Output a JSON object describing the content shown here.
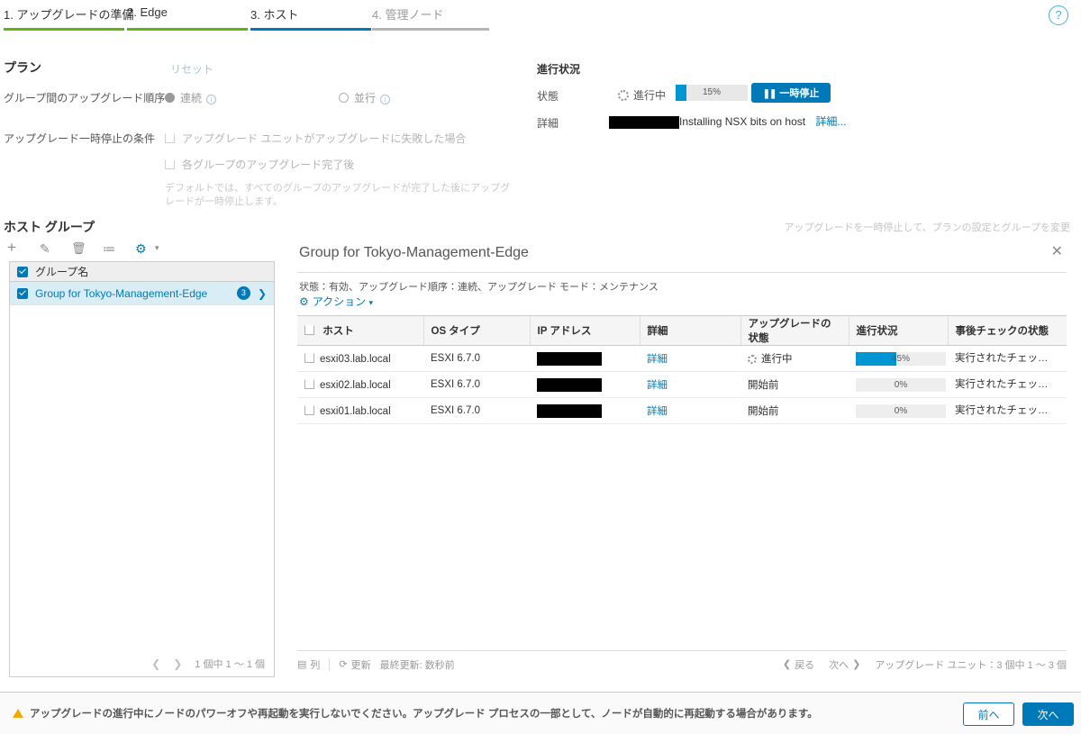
{
  "wizard": {
    "tabs": [
      {
        "label": "1. アップグレードの準備",
        "state": "done"
      },
      {
        "label": "2. Edge",
        "state": "done"
      },
      {
        "label": "3. ホスト",
        "state": "current"
      },
      {
        "label": "4. 管理ノード",
        "state": "future"
      }
    ],
    "help_icon": "?"
  },
  "plan": {
    "title": "プラン",
    "reset_label": "リセット",
    "order_label": "グループ間のアップグレード順序",
    "order_options": [
      {
        "label": "連続",
        "selected": true
      },
      {
        "label": "並行",
        "selected": false
      }
    ],
    "pause_condition_label": "アップグレード一時停止の条件",
    "pause_conditions": [
      {
        "label": "アップグレード ユニットがアップグレードに失敗した場合",
        "checked": false
      },
      {
        "label": "各グループのアップグレード完了後",
        "checked": false
      }
    ],
    "note": "デフォルトでは、すべてのグループのアップグレードが完了した後にアップグレードが一時停止します。"
  },
  "progress": {
    "title": "進行状況",
    "state_label": "状態",
    "state_value": "進行中",
    "percent_text": "15%",
    "percent": 15,
    "pause_button": "一時停止",
    "detail_label": "詳細",
    "detail_text": "Installing NSX bits on host",
    "detail_link": "詳細..."
  },
  "host_groups": {
    "title": "ホスト グループ",
    "hint": "アップグレードを一時停止して、プランの設定とグループを変更",
    "toolbar": [
      {
        "name": "add-icon",
        "glyph": "+"
      },
      {
        "name": "edit-icon",
        "glyph": "✎"
      },
      {
        "name": "delete-icon",
        "glyph": "🗑"
      },
      {
        "name": "reorder-icon",
        "glyph": "≔"
      },
      {
        "name": "settings-icon",
        "glyph": "⚙"
      }
    ],
    "column_header": "グループ名",
    "rows": [
      {
        "name": "Group for Tokyo-Management-Edge",
        "count": "3",
        "selected": true
      }
    ],
    "footer_count": "1 個中 1 ～ 1 個"
  },
  "detail_panel": {
    "title": "Group for Tokyo-Management-Edge",
    "close_label": "✕",
    "meta": "状態：有効、アップグレード順序：連続、アップグレード モード：メンテナンス",
    "actions_label": "アクション",
    "columns": [
      "ホスト",
      "OS タイプ",
      "IP アドレス",
      "詳細",
      "アップグレードの状態",
      "進行状況",
      "事後チェックの状態"
    ],
    "rows": [
      {
        "host": "esxi03.lab.local",
        "os_type": "ESXI 6.7.0",
        "ip_address": "",
        "detail": "詳細",
        "upgrade_state": "進行中",
        "upgrade_state_spinner": true,
        "progress": 45,
        "progress_text": "45%",
        "post_check": "実行されたチェッ…"
      },
      {
        "host": "esxi02.lab.local",
        "os_type": "ESXI 6.7.0",
        "ip_address": "",
        "detail": "詳細",
        "upgrade_state": "開始前",
        "upgrade_state_spinner": false,
        "progress": 0,
        "progress_text": "0%",
        "post_check": "実行されたチェッ…"
      },
      {
        "host": "esxi01.lab.local",
        "os_type": "ESXI 6.7.0",
        "ip_address": "",
        "detail": "詳細",
        "upgrade_state": "開始前",
        "upgrade_state_spinner": false,
        "progress": 0,
        "progress_text": "0%",
        "post_check": "実行されたチェッ…"
      }
    ],
    "footer": {
      "columns_label": "列",
      "refresh_label": "更新",
      "last_updated": "最終更新: 数秒前",
      "prev_label": "戻る",
      "next_label": "次へ",
      "count_label": "アップグレード ユニット：3 個中 1 ～ 3 個"
    }
  },
  "bottom": {
    "warning": "アップグレードの進行中にノードのパワーオフや再起動を実行しないでください。アップグレード プロセスの一部として、ノードが自動的に再起動する場合があります。",
    "prev_button": "前へ",
    "next_button": "次へ"
  },
  "colors": {
    "accent": "#0079b8",
    "progress": "#0095d3",
    "done_green": "#60b515",
    "warning": "#f0ab00"
  }
}
